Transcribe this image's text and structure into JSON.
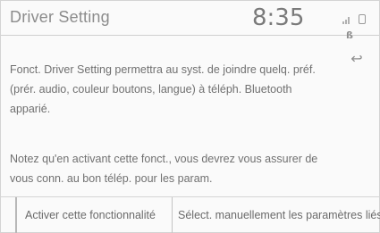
{
  "header": {
    "title": "Driver Setting",
    "clock": "8:35",
    "status_icons": [
      "signal-icon",
      "phone-icon",
      "bluetooth-icon"
    ],
    "bluetooth_glyph": "ß"
  },
  "back_button_glyph": "↩",
  "body": {
    "paragraph1": "Fonct. Driver Setting permettra au syst. de joindre quelq. préf. (prér. audio, couleur boutons, langue) à téléph. Bluetooth apparié.",
    "paragraph2": "Notez qu'en activant cette fonct., vous devrez vous assurer de vous conn. au bon télép. pour les param."
  },
  "buttons": {
    "activate": "Activer cette fonctionnalité",
    "manual_select": "Sélect. manuellement les paramètres liés"
  },
  "colors": {
    "background": "#fafafa",
    "text": "#707070",
    "title": "#8c8c8c"
  }
}
